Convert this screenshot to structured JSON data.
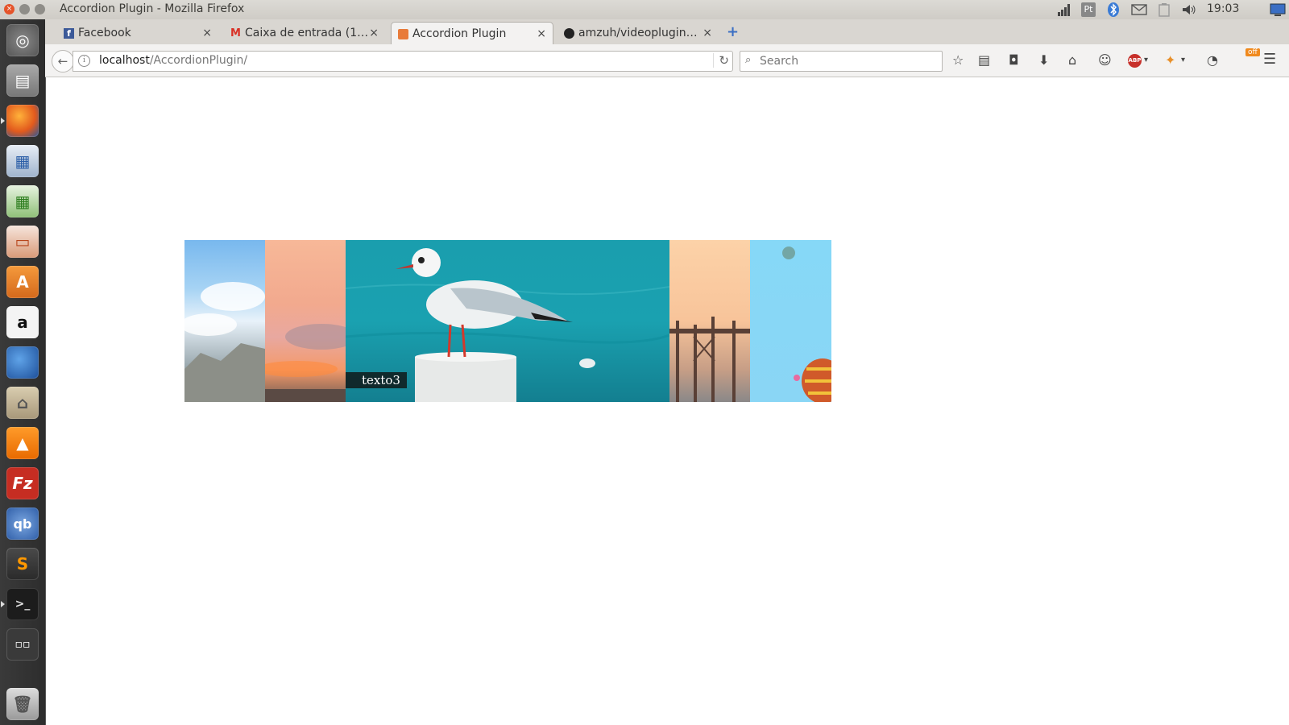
{
  "window": {
    "title": "Accordion Plugin - Mozilla Firefox",
    "clock": "19:03",
    "tray_icons": [
      "network-icon",
      "keyboard-layout-icon",
      "bluetooth-icon",
      "mail-icon",
      "battery-icon",
      "volume-icon",
      "session-icon"
    ],
    "keyboard_layout": "Pt"
  },
  "launcher": {
    "items": [
      "dash-home-icon",
      "files-icon",
      "firefox-icon",
      "writer-icon",
      "calc-icon",
      "impress-icon",
      "software-center-icon",
      "amazon-icon",
      "thunderbird-icon",
      "home-folder-icon",
      "vlc-icon",
      "filezilla-icon",
      "qbittorrent-icon",
      "sublime-text-icon",
      "terminal-icon",
      "workspace-switcher-icon",
      "trash-icon"
    ]
  },
  "tabs": [
    {
      "label": "Facebook",
      "icon": "facebook-icon",
      "active": false
    },
    {
      "label": "Caixa de entrada (1…",
      "icon": "gmail-icon",
      "active": false
    },
    {
      "label": "Accordion Plugin",
      "icon": "plugin-icon",
      "active": true
    },
    {
      "label": "amzuh/videoplugin…",
      "icon": "github-icon",
      "active": false
    }
  ],
  "close_glyph": "×",
  "new_tab_glyph": "+",
  "navbar": {
    "url_host": "localhost",
    "url_path": "/AccordionPlugin/",
    "search_placeholder": "Search",
    "ext_badge": "off"
  },
  "accordion": {
    "panels": [
      {
        "name": "sky-clouds-panel",
        "caption": ""
      },
      {
        "name": "sunset-clouds-panel",
        "caption": ""
      },
      {
        "name": "seagull-panel",
        "caption": "texto3"
      },
      {
        "name": "pier-panel",
        "caption": ""
      },
      {
        "name": "balloons-panel",
        "caption": ""
      }
    ],
    "expanded_index": 2
  },
  "colors": {
    "sea": "#1aa1b0",
    "sky": "#8fd3f2",
    "sunset": "#f5b08c",
    "close_button": "#e5542a"
  }
}
